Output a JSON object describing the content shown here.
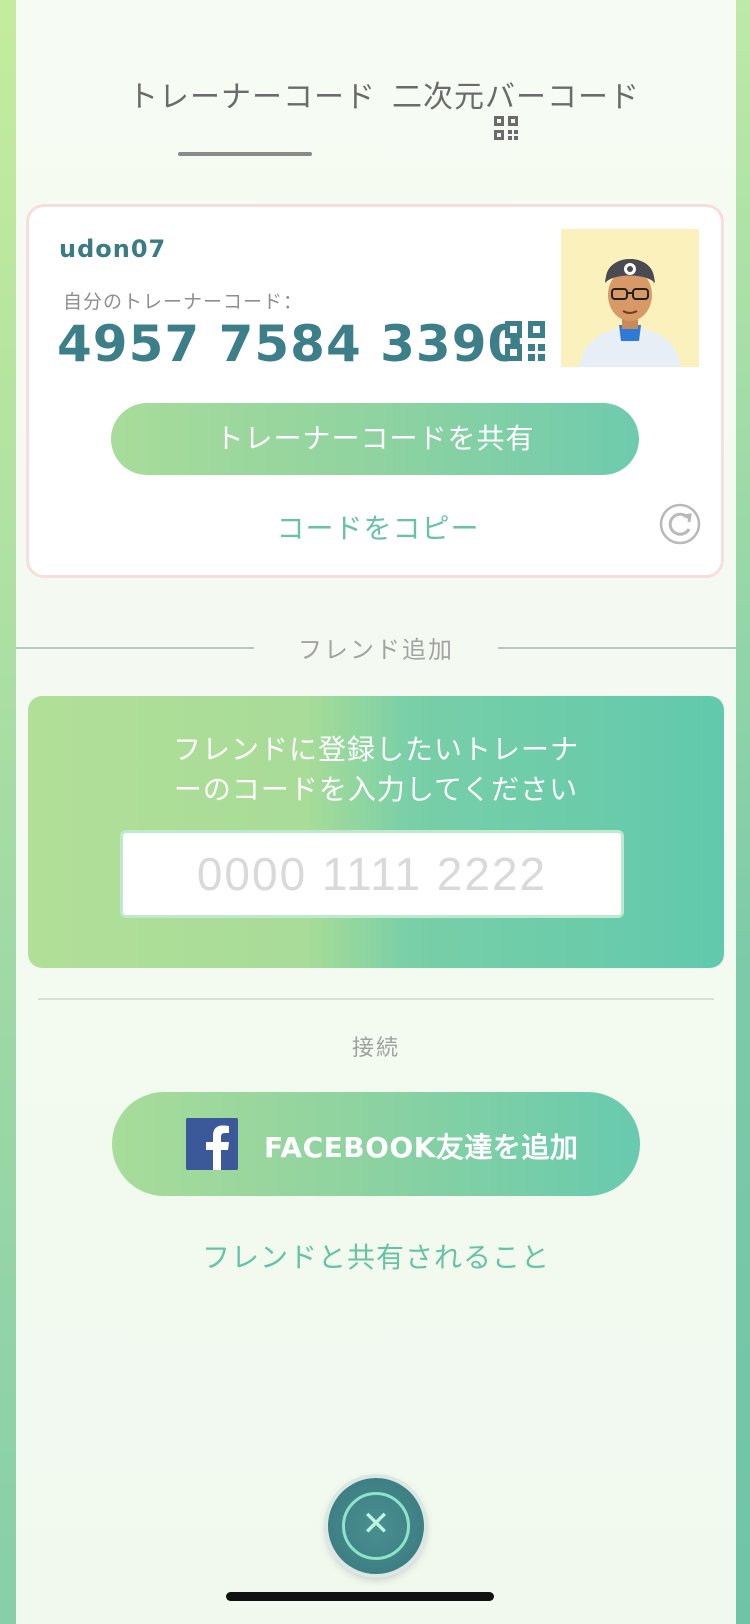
{
  "status": {
    "text": ""
  },
  "tabs": [
    {
      "label": "トレーナーコード"
    },
    {
      "label": "二次元バーコード"
    }
  ],
  "trainer": {
    "username": "udon07",
    "code_label": "自分のトレーナーコード：",
    "code": "4957 7584 3390",
    "share_label": "トレーナーコードを共有",
    "copy_label": "コードをコピー"
  },
  "add_friend": {
    "section_title": "フレンド追加",
    "prompt_line1": "フレンドに登録したいトレーナ",
    "prompt_line2": "ーのコードを入力してください",
    "input_placeholder": "0000 1111 2222",
    "input_value": ""
  },
  "connect": {
    "label": "接続",
    "facebook_label": "FACEBOOK友達を追加",
    "shared_info": "フレンドと共有されること"
  },
  "colors": {
    "accent_teal": "#68c2a5",
    "code_text": "#3d7f89",
    "facebook": "#3b5998"
  },
  "icons": {
    "tab_qr": "qr-code-icon",
    "card_qr": "qr-code-icon",
    "refresh": "refresh-icon",
    "facebook": "facebook-icon",
    "close": "close-icon"
  }
}
